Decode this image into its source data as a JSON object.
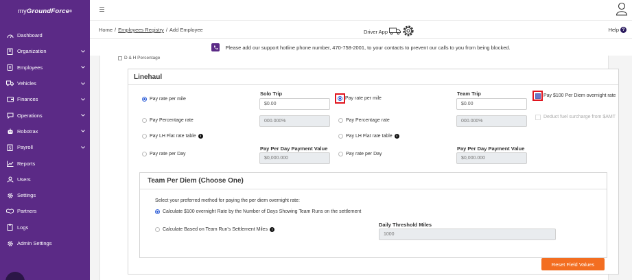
{
  "brand": {
    "prefix": "my",
    "name": "GroundForce",
    "mark": "®"
  },
  "sidebar": {
    "items": [
      {
        "label": "Dashboard",
        "icon": "dashboard-icon",
        "expandable": false
      },
      {
        "label": "Organization",
        "icon": "building-icon",
        "expandable": true
      },
      {
        "label": "Employees",
        "icon": "id-card-icon",
        "expandable": true
      },
      {
        "label": "Vehicles",
        "icon": "truck-icon",
        "expandable": true
      },
      {
        "label": "Finances",
        "icon": "wallet-icon",
        "expandable": true
      },
      {
        "label": "Operations",
        "icon": "chat-icon",
        "expandable": true
      },
      {
        "label": "Robotrax",
        "icon": "robot-icon",
        "expandable": true
      },
      {
        "label": "Payroll",
        "icon": "payroll-icon",
        "expandable": true
      },
      {
        "label": "Reports",
        "icon": "chart-icon",
        "expandable": false
      },
      {
        "label": "Users",
        "icon": "users-icon",
        "expandable": false
      },
      {
        "label": "Settings",
        "icon": "gear-icon",
        "expandable": false
      },
      {
        "label": "Partners",
        "icon": "handshake-icon",
        "expandable": false
      },
      {
        "label": "Logs",
        "icon": "clipboard-icon",
        "expandable": false
      },
      {
        "label": "Admin Settings",
        "icon": "admin-gear-icon",
        "expandable": false
      }
    ]
  },
  "breadcrumb": {
    "home": "Home",
    "sep": "/",
    "section": "Employees Registry",
    "current": "Add Employee"
  },
  "header": {
    "driver_app": "Driver App",
    "help": "Help",
    "help_mark": "?"
  },
  "notice": {
    "text": "Please add our support hotline phone number, 470-758-2001, to your contacts to prevent our calls to you from being blocked."
  },
  "form": {
    "dh_percentage": "D & H Percentage",
    "linehaul_title": "Linehaul",
    "solo": {
      "heading": "Solo Trip",
      "options": [
        "Pay rate per mile",
        "Pay Percentage rate",
        "Pay LH Flat rate table",
        "Pay rate per Day"
      ],
      "selected": 0,
      "rate_value": "$0.00",
      "percentage_value": "000.000%",
      "per_day_label": "Pay Per Day Payment Value",
      "per_day_value": "$0,000.000"
    },
    "team": {
      "heading": "Team Trip",
      "options": [
        "Pay rate per mile",
        "Pay Percentage rate",
        "Pay LH Flat rate table",
        "Pay rate per Day"
      ],
      "selected": 0,
      "rate_value": "$0.00",
      "percentage_value": "000.000%",
      "per_day_label": "Pay Per Day Payment Value",
      "per_day_value": "$0,000.000"
    },
    "checkboxes": [
      {
        "label": "Pay $100 Per Diem overnight rate",
        "checked": true,
        "disabled": false
      },
      {
        "label": "Deduct fuel surcharge from $AMT",
        "checked": false,
        "disabled": true
      }
    ],
    "team_per_diem": {
      "title": "Team Per Diem (Choose One)",
      "description": "Select your preferred method for paying the per diem overnight rate:",
      "options": [
        "Calculate $100 overnight Rate by the Number of Days Showing Team Runs on the settlement",
        "Calculate Based on Team Run's Settlement Miles"
      ],
      "selected": 0,
      "threshold_label": "Daily Threshold Miles",
      "threshold_value": "1000"
    },
    "reset_label": "Reset Field Values"
  },
  "colors": {
    "sidebar": "#5b2a86",
    "accent": "#f36e21",
    "radio": "#2a5bd7",
    "highlight": "#e0141e"
  }
}
